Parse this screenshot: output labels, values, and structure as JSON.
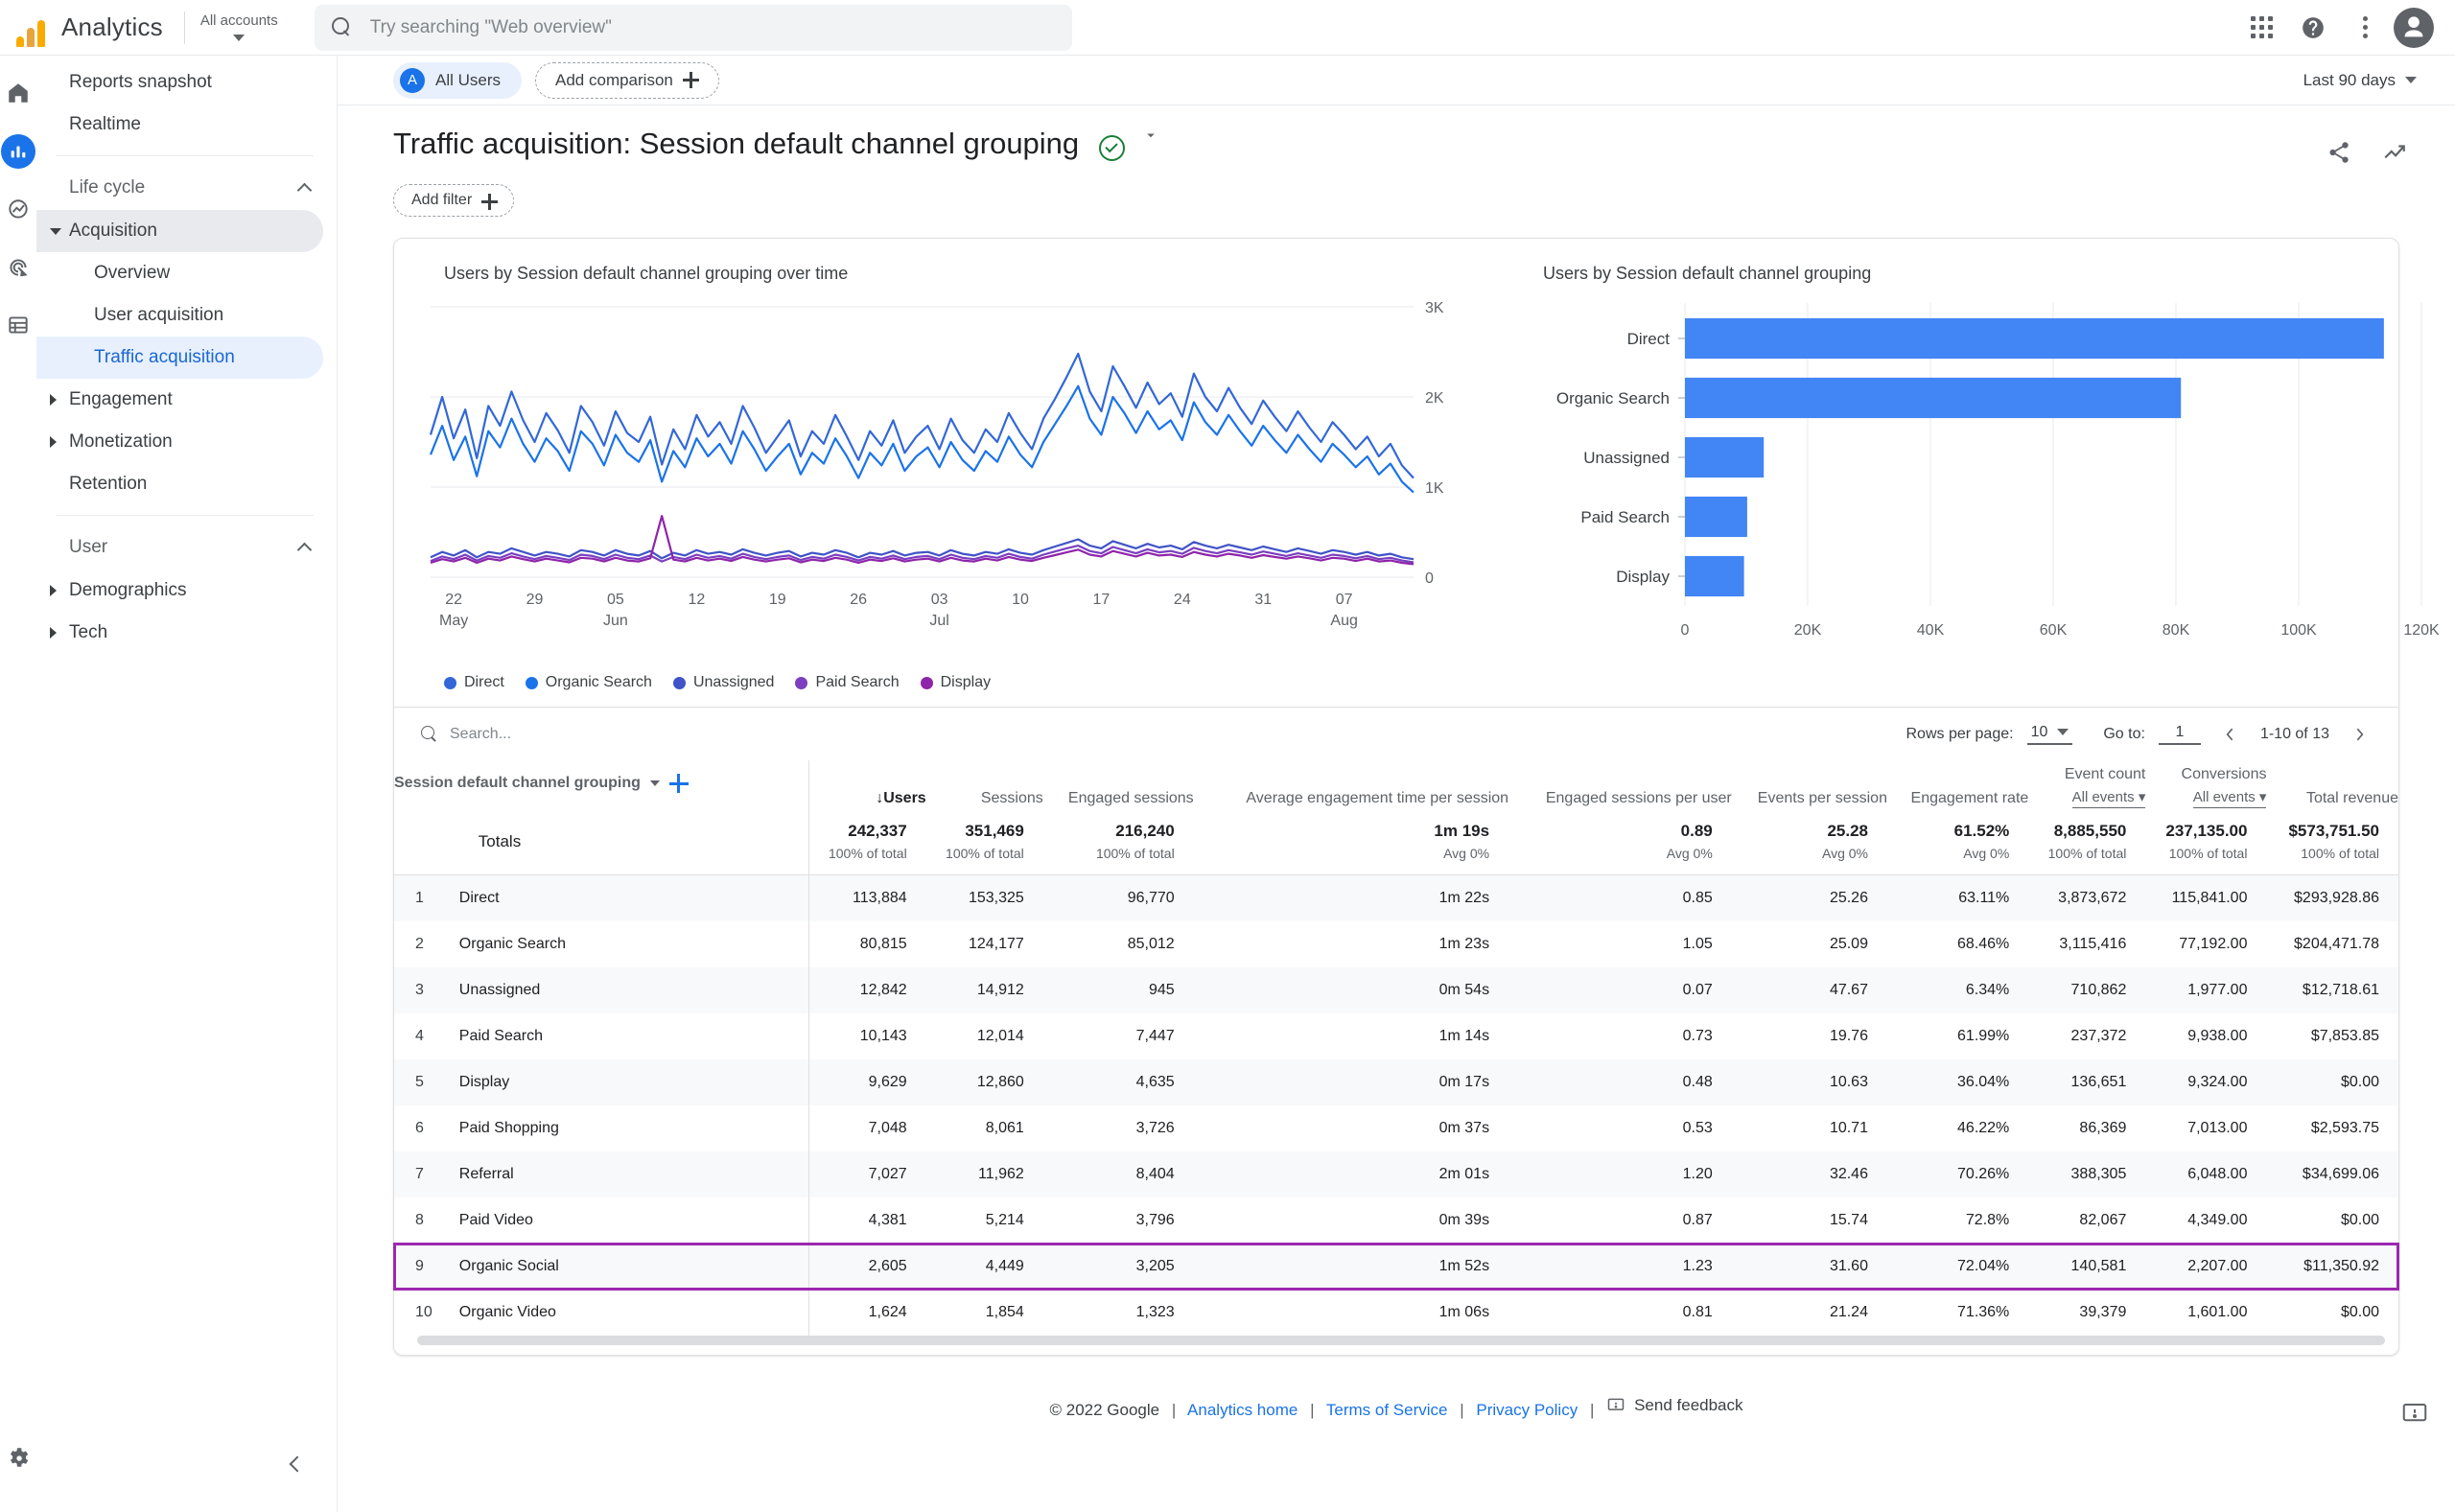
{
  "topbar": {
    "brand": "Analytics",
    "account_label": "All accounts",
    "search_placeholder": "Try searching \"Web overview\"",
    "apps_icon": "apps-grid-icon",
    "help_icon": "help-icon",
    "more_icon": "more-vert-icon",
    "avatar_icon": "user-avatar"
  },
  "rail": {
    "items": [
      {
        "name": "home-icon",
        "label": "Home"
      },
      {
        "name": "reports-icon",
        "label": "Reports"
      },
      {
        "name": "explore-icon",
        "label": "Explore"
      },
      {
        "name": "advertising-icon",
        "label": "Advertising"
      },
      {
        "name": "configure-icon",
        "label": "Configure"
      }
    ],
    "settings_label": "Admin"
  },
  "sidebar": {
    "top_items": [
      {
        "label": "Reports snapshot"
      },
      {
        "label": "Realtime"
      }
    ],
    "groups": [
      {
        "label": "Life cycle",
        "items": [
          {
            "label": "Acquisition",
            "state": "expanded-active"
          },
          {
            "label": "Overview",
            "state": "sub"
          },
          {
            "label": "User acquisition",
            "state": "sub"
          },
          {
            "label": "Traffic acquisition",
            "state": "sub-selected"
          },
          {
            "label": "Engagement",
            "state": "collapsed"
          },
          {
            "label": "Monetization",
            "state": "collapsed"
          },
          {
            "label": "Retention",
            "state": "plain"
          }
        ]
      },
      {
        "label": "User",
        "items": [
          {
            "label": "Demographics",
            "state": "collapsed"
          },
          {
            "label": "Tech",
            "state": "collapsed"
          }
        ]
      }
    ],
    "collapse_label": "Collapse navigation"
  },
  "comparison_bar": {
    "all_users": "All Users",
    "all_users_initial": "A",
    "add_comparison": "Add comparison",
    "date_range": "Last 90 days"
  },
  "report": {
    "title": "Traffic acquisition: Session default channel grouping",
    "add_filter": "Add filter",
    "share_icon": "share-icon",
    "insights_icon": "insights-trend-icon",
    "status_icon": "check-circle-icon"
  },
  "chart_data": [
    {
      "type": "line",
      "title": "Users by Session default channel grouping over time",
      "xlabel": "",
      "ylabel": "",
      "ylim": [
        0,
        3000
      ],
      "ytick_labels": [
        "3K",
        "2K",
        "1K",
        "0"
      ],
      "xtick_labels": [
        {
          "day": "22",
          "month": "May"
        },
        {
          "day": "29",
          "month": ""
        },
        {
          "day": "05",
          "month": "Jun"
        },
        {
          "day": "12",
          "month": ""
        },
        {
          "day": "19",
          "month": ""
        },
        {
          "day": "26",
          "month": ""
        },
        {
          "day": "03",
          "month": "Jul"
        },
        {
          "day": "10",
          "month": ""
        },
        {
          "day": "17",
          "month": ""
        },
        {
          "day": "24",
          "month": ""
        },
        {
          "day": "31",
          "month": ""
        },
        {
          "day": "07",
          "month": "Aug"
        }
      ],
      "legend_position": "bottom",
      "grid": true,
      "series": [
        {
          "name": "Direct",
          "color": "#3367d6",
          "values": [
            1580,
            2000,
            1540,
            1860,
            1320,
            1900,
            1680,
            2060,
            1740,
            1500,
            1820,
            1630,
            1380,
            1900,
            1720,
            1460,
            1840,
            1600,
            1500,
            1780,
            1250,
            1640,
            1420,
            1800,
            1560,
            1720,
            1480,
            1900,
            1660,
            1380,
            1560,
            1740,
            1340,
            1620,
            1480,
            1800,
            1560,
            1300,
            1620,
            1460,
            1740,
            1380,
            1560,
            1680,
            1420,
            1760,
            1520,
            1380,
            1640,
            1500,
            1820,
            1600,
            1420,
            1760,
            1980,
            2220,
            2480,
            2060,
            1840,
            2340,
            2120,
            1880,
            2160,
            1920,
            2040,
            1780,
            2260,
            2000,
            1840,
            2100,
            1880,
            1700,
            1960,
            1780,
            1620,
            1840,
            1660,
            1500,
            1720,
            1580,
            1420,
            1560,
            1340,
            1480,
            1240,
            1100
          ]
        },
        {
          "name": "Organic Search",
          "color": "#1a73e8",
          "values": [
            1360,
            1680,
            1300,
            1560,
            1120,
            1620,
            1440,
            1760,
            1480,
            1280,
            1540,
            1400,
            1180,
            1620,
            1480,
            1240,
            1580,
            1380,
            1280,
            1520,
            1060,
            1400,
            1220,
            1540,
            1340,
            1480,
            1260,
            1620,
            1420,
            1180,
            1340,
            1480,
            1140,
            1380,
            1260,
            1540,
            1340,
            1100,
            1380,
            1240,
            1480,
            1180,
            1340,
            1440,
            1220,
            1500,
            1300,
            1180,
            1400,
            1280,
            1560,
            1360,
            1220,
            1500,
            1700,
            1900,
            2120,
            1760,
            1580,
            2000,
            1820,
            1600,
            1840,
            1640,
            1740,
            1520,
            1940,
            1720,
            1580,
            1800,
            1620,
            1460,
            1680,
            1520,
            1380,
            1580,
            1420,
            1280,
            1480,
            1360,
            1220,
            1340,
            1140,
            1260,
            1060,
            940
          ]
        },
        {
          "name": "Unassigned",
          "color": "#4053c7",
          "values": [
            220,
            280,
            240,
            300,
            220,
            280,
            260,
            320,
            280,
            240,
            280,
            260,
            230,
            300,
            280,
            240,
            300,
            260,
            240,
            290,
            210,
            270,
            240,
            300,
            260,
            280,
            250,
            310,
            270,
            240,
            270,
            290,
            230,
            270,
            250,
            300,
            270,
            220,
            270,
            250,
            290,
            240,
            270,
            280,
            240,
            300,
            260,
            240,
            280,
            260,
            310,
            270,
            250,
            300,
            340,
            380,
            420,
            350,
            320,
            400,
            360,
            320,
            370,
            330,
            350,
            310,
            390,
            350,
            320,
            360,
            330,
            300,
            340,
            310,
            280,
            320,
            290,
            260,
            300,
            280,
            250,
            280,
            240,
            260,
            220,
            200
          ]
        },
        {
          "name": "Paid Search",
          "color": "#7b3fc0",
          "values": [
            180,
            230,
            200,
            250,
            185,
            235,
            215,
            265,
            230,
            200,
            235,
            215,
            190,
            250,
            235,
            200,
            250,
            215,
            200,
            240,
            175,
            225,
            200,
            250,
            215,
            235,
            205,
            260,
            225,
            200,
            225,
            240,
            190,
            225,
            205,
            250,
            225,
            185,
            225,
            205,
            240,
            200,
            225,
            235,
            200,
            250,
            215,
            200,
            235,
            215,
            260,
            225,
            205,
            250,
            285,
            320,
            350,
            290,
            265,
            335,
            300,
            265,
            310,
            275,
            290,
            260,
            325,
            290,
            265,
            300,
            275,
            250,
            285,
            260,
            235,
            265,
            240,
            215,
            250,
            235,
            210,
            235,
            200,
            215,
            185,
            165
          ]
        },
        {
          "name": "Display",
          "color": "#8e24aa",
          "values": [
            160,
            200,
            175,
            215,
            160,
            205,
            185,
            230,
            200,
            175,
            205,
            185,
            165,
            215,
            205,
            175,
            215,
            185,
            175,
            210,
            680,
            195,
            175,
            215,
            185,
            205,
            180,
            225,
            195,
            175,
            195,
            210,
            165,
            195,
            180,
            215,
            195,
            160,
            195,
            180,
            210,
            175,
            195,
            205,
            175,
            215,
            185,
            175,
            205,
            185,
            225,
            195,
            180,
            215,
            245,
            275,
            305,
            250,
            230,
            290,
            260,
            230,
            270,
            240,
            250,
            225,
            280,
            250,
            230,
            260,
            240,
            215,
            245,
            225,
            205,
            230,
            210,
            185,
            215,
            205,
            180,
            205,
            175,
            185,
            160,
            145
          ]
        }
      ]
    },
    {
      "type": "bar",
      "orientation": "horizontal",
      "title": "Users by Session default channel grouping",
      "categories": [
        "Direct",
        "Organic Search",
        "Unassigned",
        "Paid Search",
        "Display"
      ],
      "values": [
        113884,
        80815,
        12842,
        10143,
        9629
      ],
      "xlim": [
        0,
        120000
      ],
      "xtick_labels": [
        "0",
        "20K",
        "40K",
        "60K",
        "80K",
        "100K",
        "120K"
      ],
      "bar_color": "#4285f4",
      "grid": true
    }
  ],
  "table": {
    "search_placeholder": "Search...",
    "rows_per_page_label": "Rows per page:",
    "rows_per_page_value": "10",
    "go_to_label": "Go to:",
    "go_to_value": "1",
    "range_label": "1-10 of 13",
    "dimension_header": "Session default channel grouping",
    "headers": [
      {
        "label": "Users",
        "sorted": true,
        "sort_arrow": "↓"
      },
      {
        "label": "Sessions"
      },
      {
        "label": "Engaged sessions"
      },
      {
        "label": "Average engagement time per session"
      },
      {
        "label": "Engaged sessions per user"
      },
      {
        "label": "Events per session"
      },
      {
        "label": "Engagement rate"
      },
      {
        "label": "Event count",
        "sub": "All events"
      },
      {
        "label": "Conversions",
        "sub": "All events"
      },
      {
        "label": "Total revenue"
      }
    ],
    "totals": {
      "label": "Totals",
      "values": [
        "242,337",
        "351,469",
        "216,240",
        "1m 19s",
        "0.89",
        "25.28",
        "61.52%",
        "8,885,550",
        "237,135.00",
        "$573,751.50"
      ],
      "subs": [
        "100% of total",
        "100% of total",
        "100% of total",
        "Avg 0%",
        "Avg 0%",
        "Avg 0%",
        "Avg 0%",
        "100% of total",
        "100% of total",
        "100% of total"
      ]
    },
    "rows": [
      {
        "idx": "1",
        "name": "Direct",
        "values": [
          "113,884",
          "153,325",
          "96,770",
          "1m 22s",
          "0.85",
          "25.26",
          "63.11%",
          "3,873,672",
          "115,841.00",
          "$293,928.86"
        ],
        "highlighted": false
      },
      {
        "idx": "2",
        "name": "Organic Search",
        "values": [
          "80,815",
          "124,177",
          "85,012",
          "1m 23s",
          "1.05",
          "25.09",
          "68.46%",
          "3,115,416",
          "77,192.00",
          "$204,471.78"
        ],
        "highlighted": false
      },
      {
        "idx": "3",
        "name": "Unassigned",
        "values": [
          "12,842",
          "14,912",
          "945",
          "0m 54s",
          "0.07",
          "47.67",
          "6.34%",
          "710,862",
          "1,977.00",
          "$12,718.61"
        ],
        "highlighted": false
      },
      {
        "idx": "4",
        "name": "Paid Search",
        "values": [
          "10,143",
          "12,014",
          "7,447",
          "1m 14s",
          "0.73",
          "19.76",
          "61.99%",
          "237,372",
          "9,938.00",
          "$7,853.85"
        ],
        "highlighted": false
      },
      {
        "idx": "5",
        "name": "Display",
        "values": [
          "9,629",
          "12,860",
          "4,635",
          "0m 17s",
          "0.48",
          "10.63",
          "36.04%",
          "136,651",
          "9,324.00",
          "$0.00"
        ],
        "highlighted": false
      },
      {
        "idx": "6",
        "name": "Paid Shopping",
        "values": [
          "7,048",
          "8,061",
          "3,726",
          "0m 37s",
          "0.53",
          "10.71",
          "46.22%",
          "86,369",
          "7,013.00",
          "$2,593.75"
        ],
        "highlighted": false
      },
      {
        "idx": "7",
        "name": "Referral",
        "values": [
          "7,027",
          "11,962",
          "8,404",
          "2m 01s",
          "1.20",
          "32.46",
          "70.26%",
          "388,305",
          "6,048.00",
          "$34,699.06"
        ],
        "highlighted": false
      },
      {
        "idx": "8",
        "name": "Paid Video",
        "values": [
          "4,381",
          "5,214",
          "3,796",
          "0m 39s",
          "0.87",
          "15.74",
          "72.8%",
          "82,067",
          "4,349.00",
          "$0.00"
        ],
        "highlighted": false
      },
      {
        "idx": "9",
        "name": "Organic Social",
        "values": [
          "2,605",
          "4,449",
          "3,205",
          "1m 52s",
          "1.23",
          "31.60",
          "72.04%",
          "140,581",
          "2,207.00",
          "$11,350.92"
        ],
        "highlighted": true
      },
      {
        "idx": "10",
        "name": "Organic Video",
        "values": [
          "1,624",
          "1,854",
          "1,323",
          "1m 06s",
          "0.81",
          "21.24",
          "71.36%",
          "39,379",
          "1,601.00",
          "$0.00"
        ],
        "highlighted": false
      }
    ],
    "highlight_color": "#9c27b0"
  },
  "footer": {
    "copyright": "© 2022 Google",
    "links": [
      "Analytics home",
      "Terms of Service",
      "Privacy Policy"
    ],
    "feedback": "Send feedback"
  }
}
